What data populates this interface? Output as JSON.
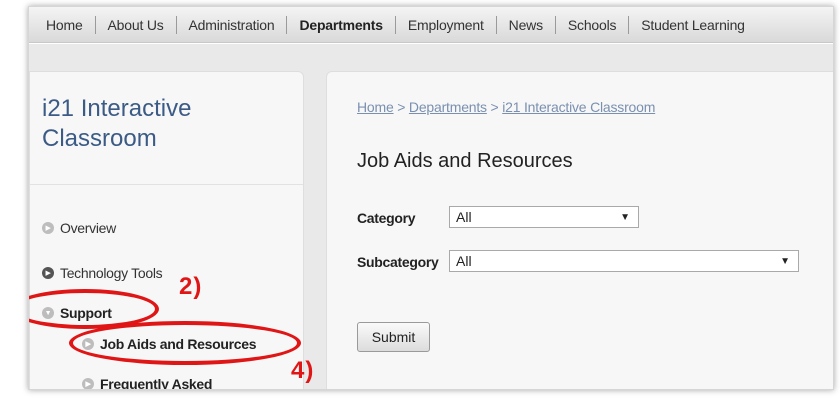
{
  "nav": {
    "items": [
      "Home",
      "About Us",
      "Administration",
      "Departments",
      "Employment",
      "News",
      "Schools",
      "Student Learning"
    ],
    "active": "Departments"
  },
  "sidebar": {
    "title": "i21 Interactive Classroom",
    "items": [
      {
        "label": "Overview"
      },
      {
        "label": "Technology Tools"
      },
      {
        "label": "Support"
      },
      {
        "label": "Job Aids and Resources"
      },
      {
        "label": "Frequently Asked"
      }
    ]
  },
  "main": {
    "breadcrumb": {
      "home": "Home",
      "sep1": " > ",
      "departments": "Departments",
      "sep2": " > ",
      "current": "i21 Interactive Classroom"
    },
    "title": "Job Aids and Resources",
    "form": {
      "category_label": "Category",
      "category_value": "All",
      "subcategory_label": "Subcategory",
      "subcategory_value": "All",
      "submit_label": "Submit"
    }
  },
  "annotations": {
    "step2": "2)",
    "step4": "4)"
  },
  "colors": {
    "annotation": "#e01515",
    "link": "#7a90b0",
    "sidebar_title": "#3b5b86"
  }
}
